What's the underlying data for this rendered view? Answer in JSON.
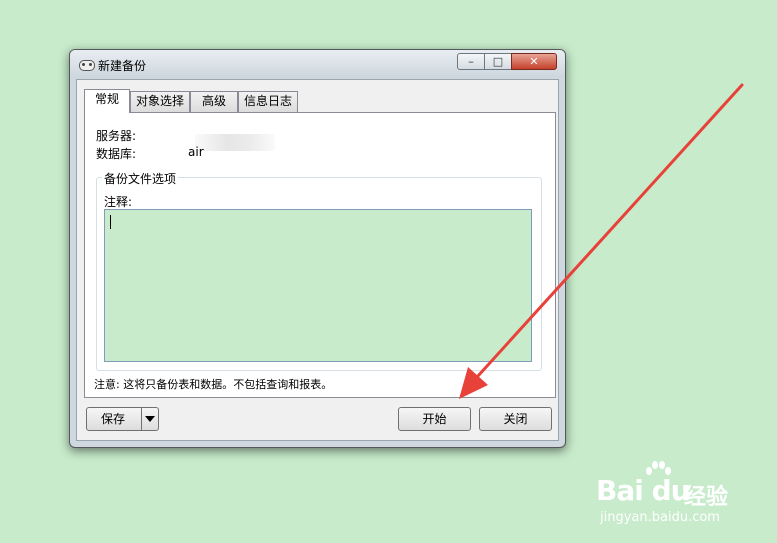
{
  "window": {
    "title": "新建备份",
    "controls": {
      "minimize": "–",
      "maximize": "□",
      "close": "✕"
    }
  },
  "tabs": [
    {
      "label": "常规",
      "active": true
    },
    {
      "label": "对象选择",
      "active": false
    },
    {
      "label": "高级",
      "active": false
    },
    {
      "label": "信息日志",
      "active": false
    }
  ],
  "general": {
    "server_label": "服务器:",
    "server_value": "",
    "database_label": "数据库:",
    "database_value": "air",
    "group_title": "备份文件选项",
    "comment_label": "注释:",
    "comment_value": "",
    "note": "注意: 这将只备份表和数据。不包括查询和报表。"
  },
  "buttons": {
    "save": "保存",
    "start": "开始",
    "close": "关闭"
  },
  "annotation": {
    "arrow_color": "#e8413a"
  },
  "watermark": {
    "logo": "Bai du",
    "brand_cn": "经验",
    "url": "jingyan.baidu.com"
  }
}
